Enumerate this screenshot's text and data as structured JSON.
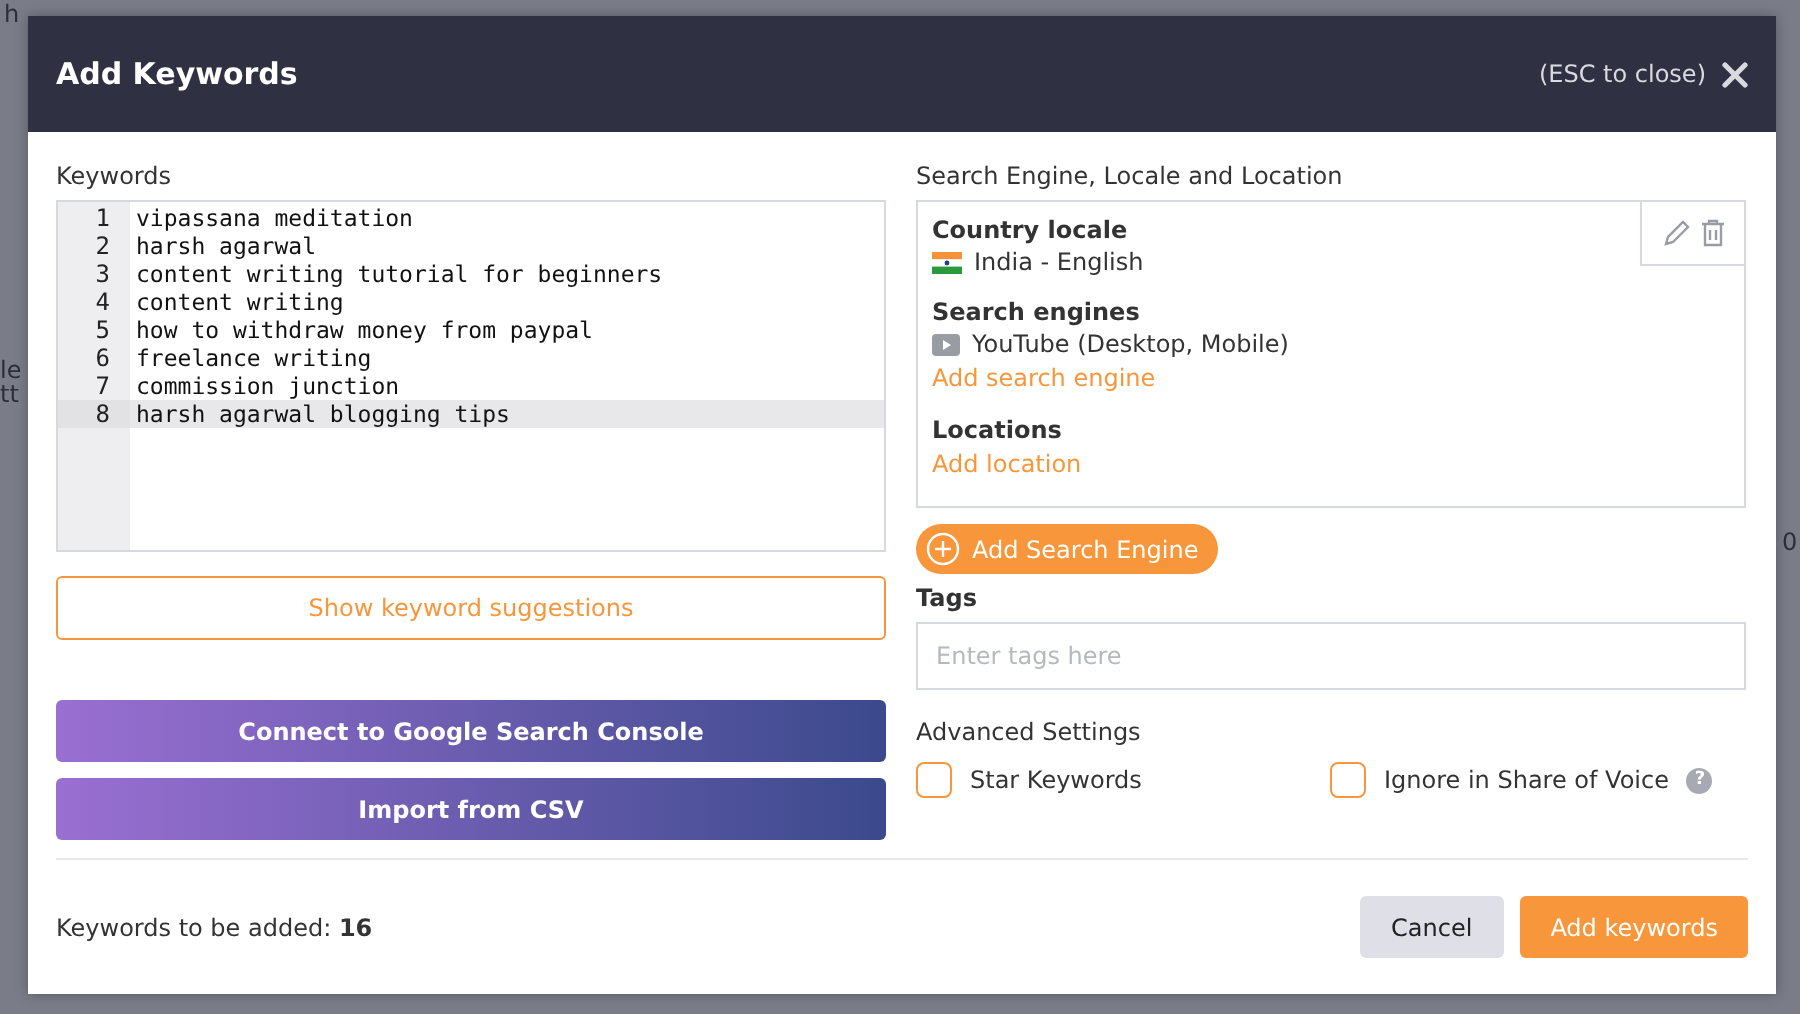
{
  "background": {
    "texts": [
      "h",
      "le",
      "tt",
      "0"
    ]
  },
  "modal": {
    "title": "Add Keywords",
    "close_hint": "(ESC to close)",
    "keywords": {
      "label": "Keywords",
      "lines": [
        {
          "number": "1",
          "text": "vipassana meditation",
          "selected": false
        },
        {
          "number": "2",
          "text": "harsh agarwal",
          "selected": false
        },
        {
          "number": "3",
          "text": "content writing tutorial for beginners",
          "selected": false
        },
        {
          "number": "4",
          "text": "content writing",
          "selected": false
        },
        {
          "number": "5",
          "text": "how to withdraw money from paypal",
          "selected": false
        },
        {
          "number": "6",
          "text": "freelance writing",
          "selected": false
        },
        {
          "number": "7",
          "text": "commission junction",
          "selected": false
        },
        {
          "number": "8",
          "text": "harsh agarwal blogging tips",
          "selected": true
        }
      ]
    },
    "suggestions_button": "Show keyword suggestions",
    "import_buttons": [
      "Connect to Google Search Console",
      "Import from CSV"
    ],
    "search_engine": {
      "label": "Search Engine, Locale and Location",
      "country_locale": {
        "label": "Country locale",
        "value": "India - English"
      },
      "search_engines": {
        "label": "Search engines",
        "value": "YouTube (Desktop, Mobile)",
        "link": "Add search engine"
      },
      "locations": {
        "label": "Locations",
        "link": "Add location"
      },
      "add_button": "Add Search Engine"
    },
    "tags": {
      "label": "Tags",
      "placeholder": "Enter tags here"
    },
    "advanced": {
      "label": "Advanced Settings",
      "options": [
        {
          "label": "Star Keywords",
          "checked": false
        },
        {
          "label": "Ignore in Share of Voice",
          "checked": false,
          "help_icon": "?"
        }
      ]
    },
    "footer": {
      "count_text": "Keywords to be added: **16**",
      "buttons": [
        {
          "label": "Cancel",
          "kind": "secondary"
        },
        {
          "label": "Add keywords",
          "kind": "primary"
        }
      ]
    }
  }
}
